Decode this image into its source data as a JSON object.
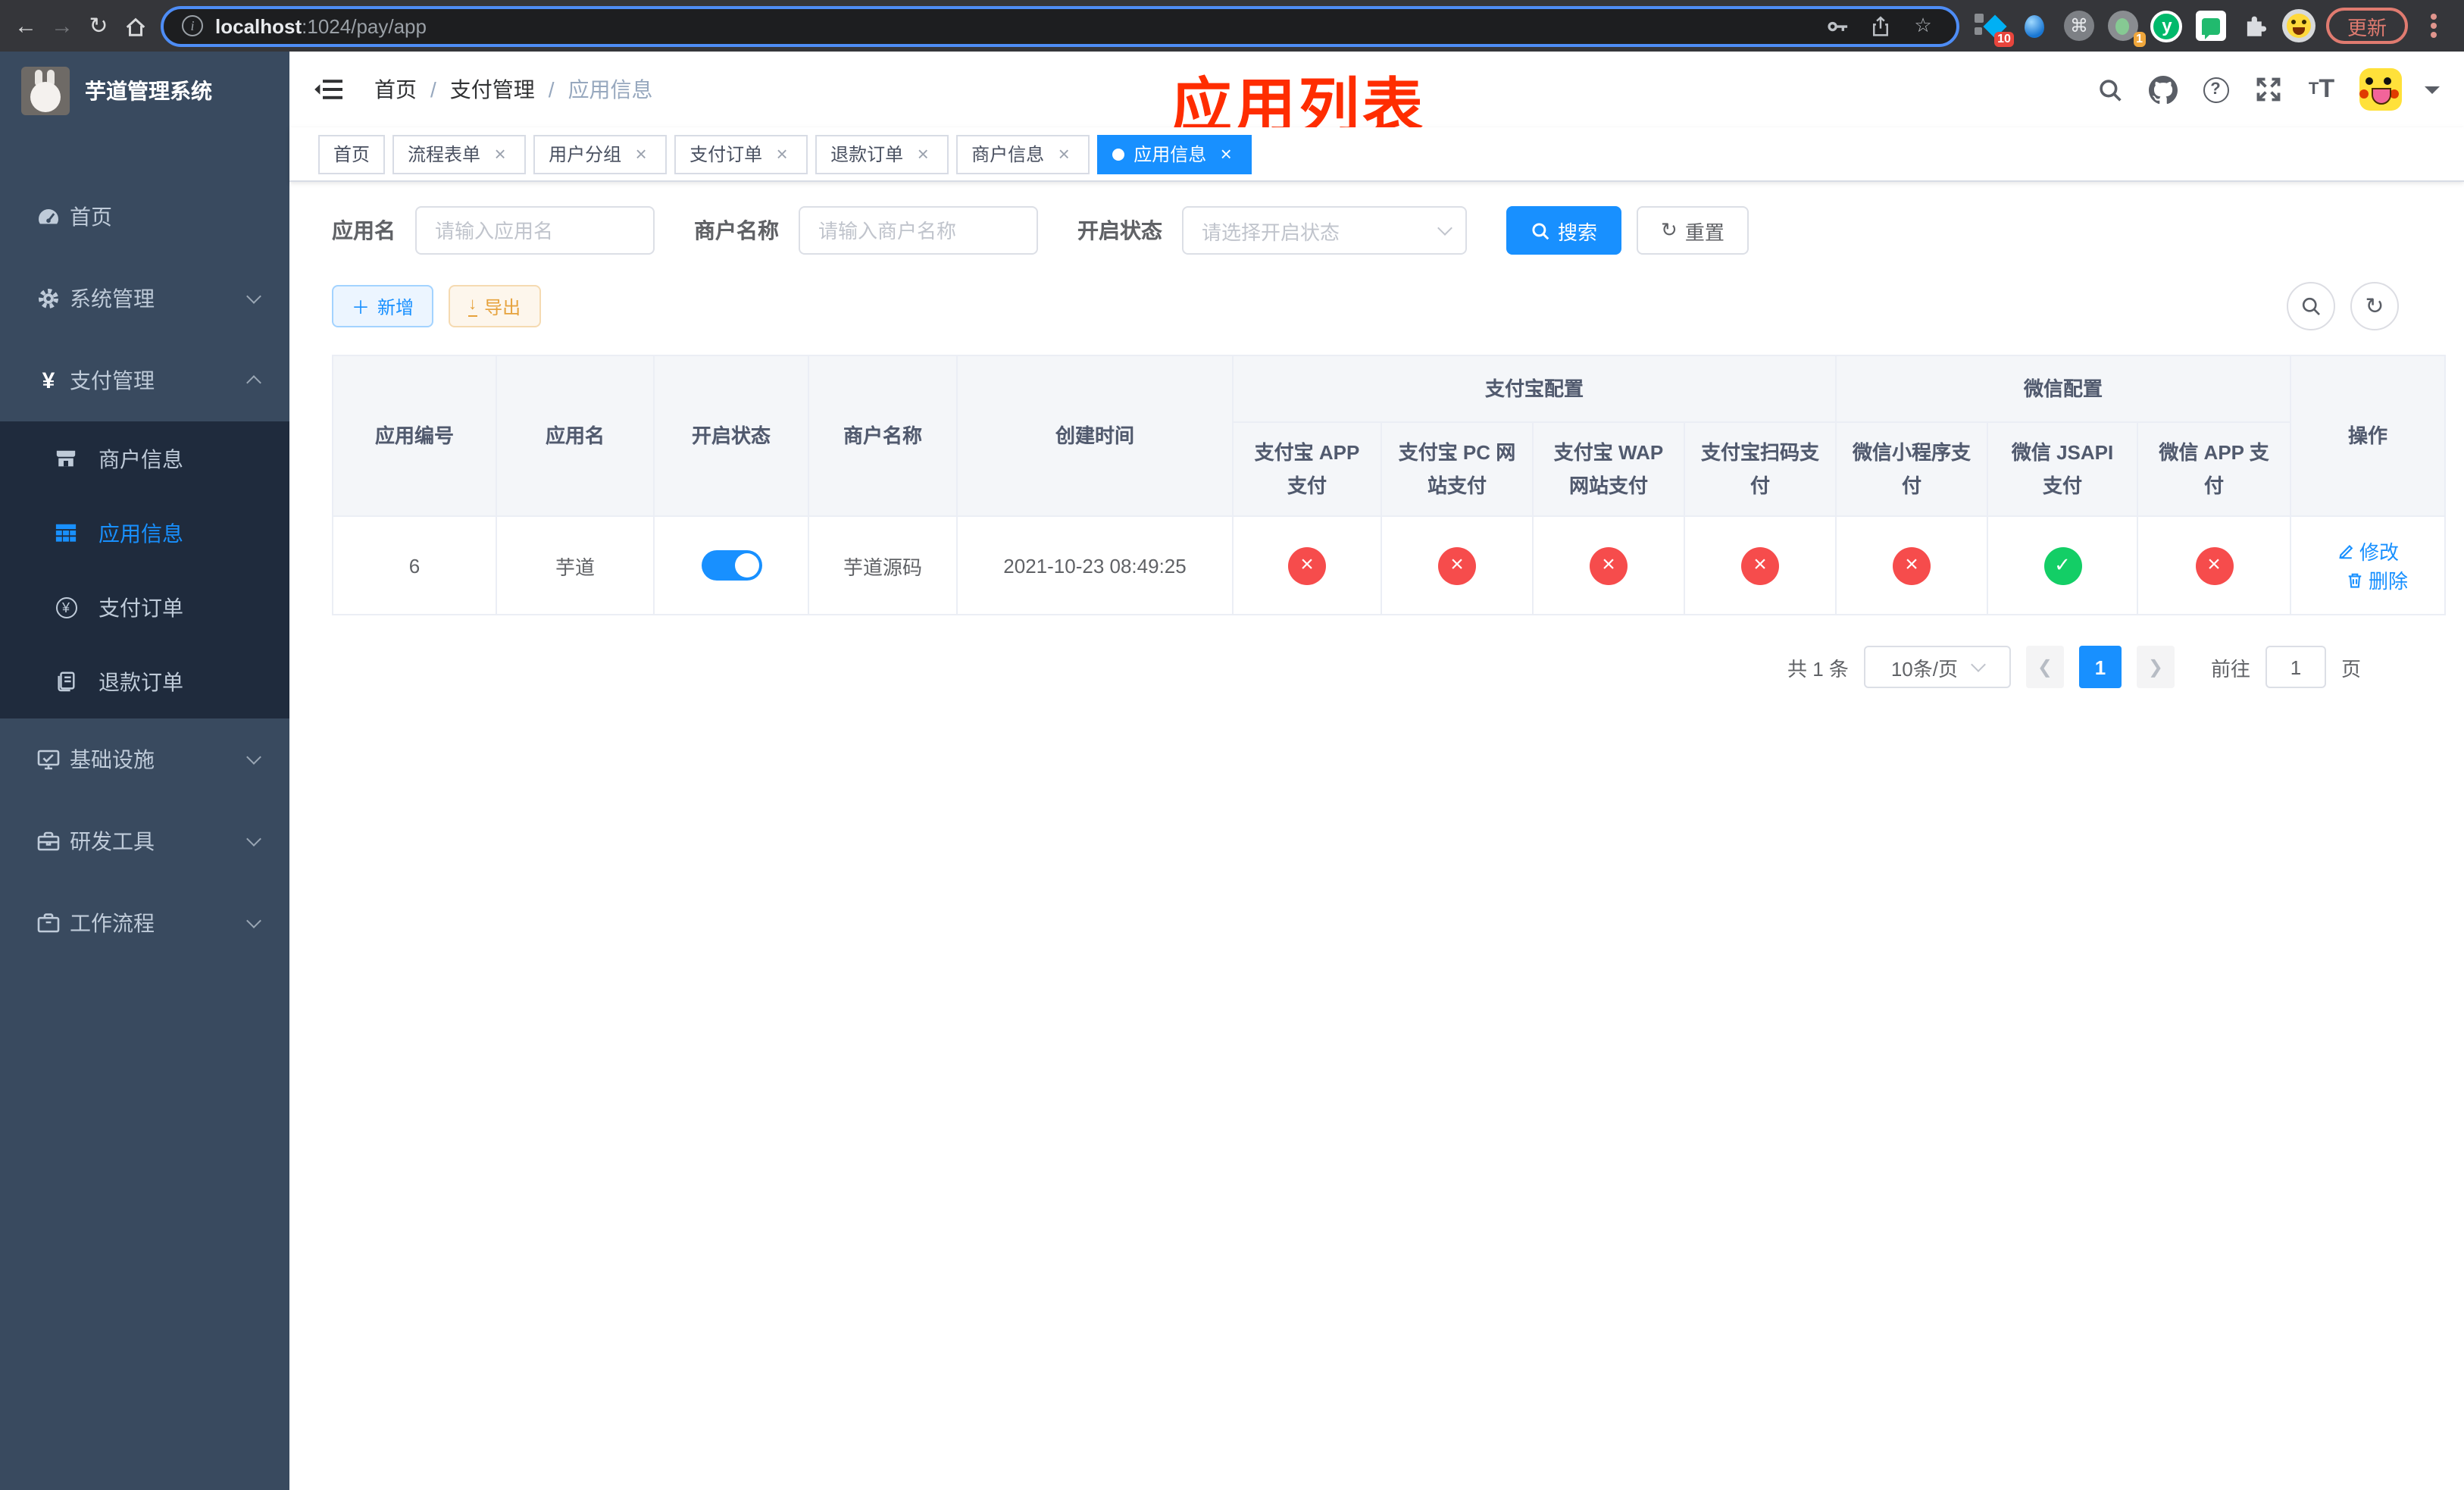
{
  "browser": {
    "url_host": "localhost",
    "url_rest": ":1024/pay/app",
    "update_label": "更新",
    "ext_badge_pinned": "10",
    "ext_badge_recorder": "1",
    "ext_yuque_letter": "y"
  },
  "sidebar": {
    "title": "芋道管理系统",
    "menu": [
      {
        "label": "首页"
      },
      {
        "label": "系统管理"
      },
      {
        "label": "支付管理"
      },
      {
        "label": "基础设施"
      },
      {
        "label": "研发工具"
      },
      {
        "label": "工作流程"
      }
    ],
    "submenu": [
      {
        "label": "商户信息"
      },
      {
        "label": "应用信息"
      },
      {
        "label": "支付订单"
      },
      {
        "label": "退款订单"
      }
    ]
  },
  "navbar": {
    "breadcrumb": [
      "首页",
      "支付管理",
      "应用信息"
    ],
    "annotation": "应用列表"
  },
  "tabs": [
    {
      "label": "首页"
    },
    {
      "label": "流程表单"
    },
    {
      "label": "用户分组"
    },
    {
      "label": "支付订单"
    },
    {
      "label": "退款订单"
    },
    {
      "label": "商户信息"
    },
    {
      "label": "应用信息"
    }
  ],
  "filters": {
    "app_name_label": "应用名",
    "app_name_placeholder": "请输入应用名",
    "merchant_label": "商户名称",
    "merchant_placeholder": "请输入商户名称",
    "status_label": "开启状态",
    "status_placeholder": "请选择开启状态",
    "search_label": "搜索",
    "reset_label": "重置"
  },
  "toolbar": {
    "add_label": "新增",
    "export_label": "导出"
  },
  "table": {
    "columns": [
      "应用编号",
      "应用名",
      "开启状态",
      "商户名称",
      "创建时间"
    ],
    "groups": {
      "alipay": "支付宝配置",
      "wechat": "微信配置",
      "actions": "操作"
    },
    "sub_columns": [
      "支付宝 APP 支付",
      "支付宝 PC 网站支付",
      "支付宝 WAP 网站支付",
      "支付宝扫码支付",
      "微信小程序支付",
      "微信 JSAPI 支付",
      "微信 APP 支付"
    ],
    "rows": [
      {
        "id": "6",
        "name": "芋道",
        "enabled": "on",
        "merchant": "芋道源码",
        "created_at": "2021-10-23 08:49:25",
        "statuses": [
          "no",
          "no",
          "no",
          "no",
          "no",
          "yes",
          "no"
        ],
        "edit_label": "修改",
        "delete_label": "删除"
      }
    ]
  },
  "pagination": {
    "total_text": "共 1 条",
    "page_size_text": "10条/页",
    "current_page": "1",
    "goto_label": "前往",
    "goto_value": "1",
    "unit_label": "页"
  },
  "colors": {
    "primary": "#1890ff",
    "danger": "#f64c4c",
    "success": "#13ce66",
    "warning": "#e6a23c",
    "annotation_red": "#ff2d00",
    "sidebar_bg": "#394a5f",
    "submenu_bg": "#1f2b3d"
  }
}
